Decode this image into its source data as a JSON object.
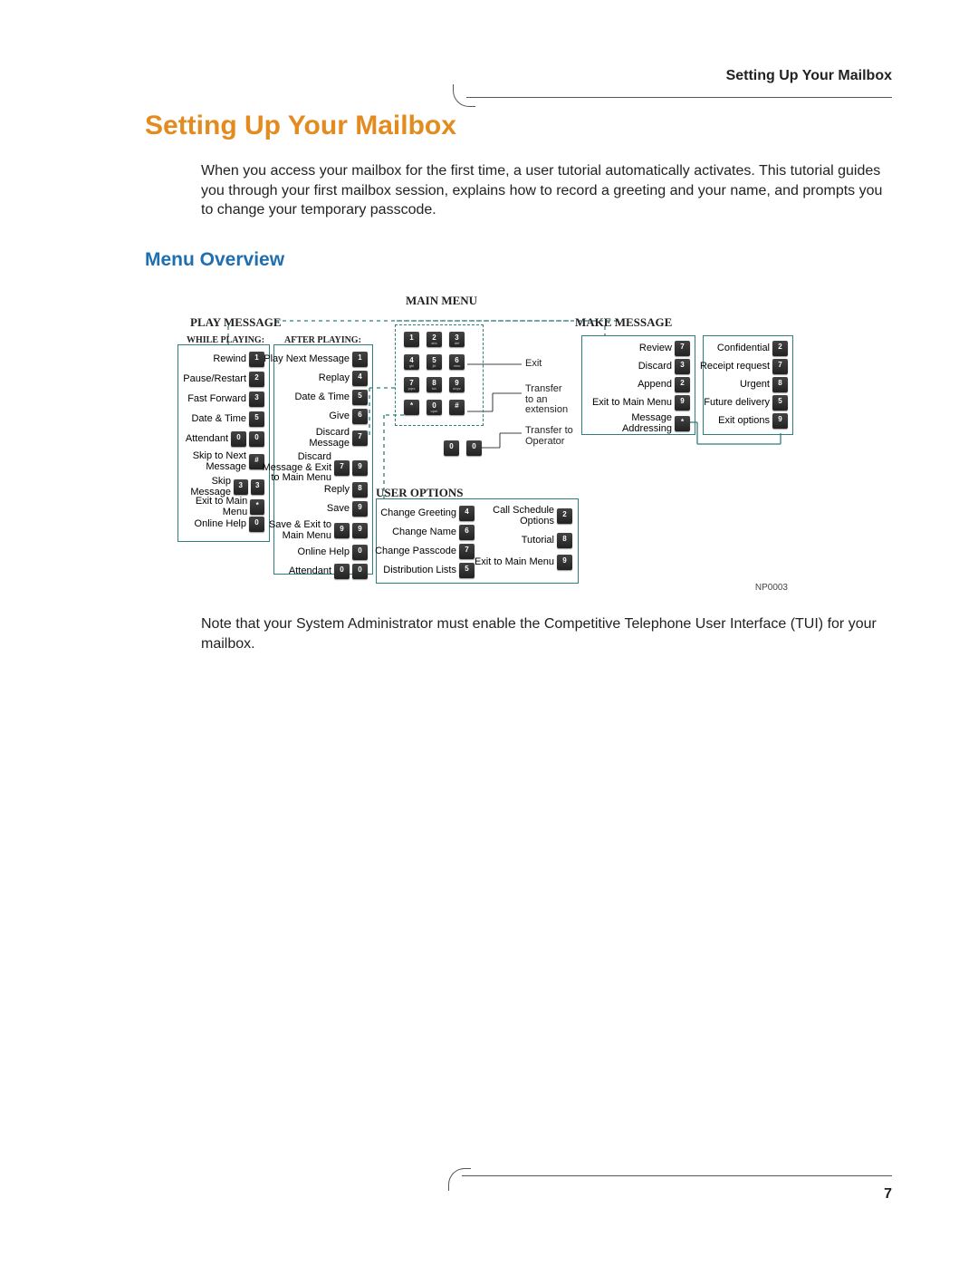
{
  "header": {
    "running_title": "Setting Up Your Mailbox"
  },
  "title": "Setting Up Your Mailbox",
  "intro": "When you access your mailbox for the first time, a user tutorial automatically activates. This tutorial guides you through your first mailbox session, explains how to record a greeting and your name, and prompts you to change your temporary passcode.",
  "section_heading": "Menu Overview",
  "note": "Note that your System Administrator must enable the Competitive Telephone User Interface (TUI) for your mailbox.",
  "page_number": "7",
  "diagram": {
    "main_menu_label": "MAIN MENU",
    "play_message_label": "PLAY MESSAGE",
    "make_message_label": "MAKE MESSAGE",
    "user_options_label": "USER OPTIONS",
    "while_playing_label": "WHILE PLAYING:",
    "after_playing_label": "AFTER PLAYING:",
    "reference": "NP0003",
    "keypad": [
      [
        "1",
        "2",
        "3"
      ],
      [
        "4",
        "5",
        "6"
      ],
      [
        "7",
        "8",
        "9"
      ],
      [
        "*",
        "0",
        "#"
      ]
    ],
    "keypad_subs": [
      [
        "",
        "abc",
        "def"
      ],
      [
        "ghi",
        "jkl",
        "mno"
      ],
      [
        "pqrs",
        "tuv",
        "wxyz"
      ],
      [
        "",
        "oper",
        ""
      ]
    ],
    "keypad_bottom": [
      "0",
      "0"
    ],
    "main_exit": {
      "exit": "Exit",
      "transfer": "Transfer\nto an\nextension",
      "operator": "Transfer to\nOperator"
    },
    "while_playing": [
      {
        "label": "Rewind",
        "keys": [
          "1"
        ]
      },
      {
        "label": "Pause/Restart",
        "keys": [
          "2"
        ]
      },
      {
        "label": "Fast Forward",
        "keys": [
          "3"
        ]
      },
      {
        "label": "Date & Time",
        "keys": [
          "5"
        ]
      },
      {
        "label": "Attendant",
        "keys": [
          "0",
          "0"
        ]
      },
      {
        "label": "Skip to Next\nMessage",
        "keys": [
          "#"
        ]
      },
      {
        "label": "Skip Message",
        "keys": [
          "3",
          "3"
        ]
      },
      {
        "label": "Exit to Main Menu",
        "keys": [
          "*"
        ]
      },
      {
        "label": "Online Help",
        "keys": [
          "0"
        ]
      }
    ],
    "after_playing": [
      {
        "label": "Play Next Message",
        "keys": [
          "1"
        ]
      },
      {
        "label": "Replay",
        "keys": [
          "4"
        ]
      },
      {
        "label": "Date & Time",
        "keys": [
          "5"
        ]
      },
      {
        "label": "Give",
        "keys": [
          "6"
        ]
      },
      {
        "label": "Discard\nMessage",
        "keys": [
          "7"
        ]
      },
      {
        "label": "Discard\nMessage & Exit\nto Main Menu",
        "keys": [
          "7",
          "9"
        ]
      },
      {
        "label": "Reply",
        "keys": [
          "8"
        ]
      },
      {
        "label": "Save",
        "keys": [
          "9"
        ]
      },
      {
        "label": "Save & Exit to\nMain Menu",
        "keys": [
          "9",
          "9"
        ]
      },
      {
        "label": "Online Help",
        "keys": [
          "0"
        ]
      },
      {
        "label": "Attendant",
        "keys": [
          "0",
          "0"
        ]
      }
    ],
    "make_message_left": [
      {
        "label": "Review",
        "keys": [
          "7"
        ]
      },
      {
        "label": "Discard",
        "keys": [
          "3"
        ]
      },
      {
        "label": "Append",
        "keys": [
          "2"
        ]
      },
      {
        "label": "Exit to Main Menu",
        "keys": [
          "9"
        ]
      },
      {
        "label": "Message\nAddressing",
        "keys": [
          "*"
        ]
      }
    ],
    "make_message_right": [
      {
        "label": "Confidential",
        "keys": [
          "2"
        ]
      },
      {
        "label": "Receipt request",
        "keys": [
          "7"
        ]
      },
      {
        "label": "Urgent",
        "keys": [
          "8"
        ]
      },
      {
        "label": "Future delivery",
        "keys": [
          "5"
        ]
      },
      {
        "label": "Exit options",
        "keys": [
          "9"
        ]
      }
    ],
    "user_options_left": [
      {
        "label": "Change Greeting",
        "keys": [
          "4"
        ]
      },
      {
        "label": "Change Name",
        "keys": [
          "6"
        ]
      },
      {
        "label": "Change Passcode",
        "keys": [
          "7"
        ]
      },
      {
        "label": "Distribution Lists",
        "keys": [
          "5"
        ]
      }
    ],
    "user_options_right": [
      {
        "label": "Call Schedule\nOptions",
        "keys": [
          "2"
        ]
      },
      {
        "label": "Tutorial",
        "keys": [
          "8"
        ]
      },
      {
        "label": "Exit to Main Menu",
        "keys": [
          "9"
        ]
      }
    ]
  }
}
